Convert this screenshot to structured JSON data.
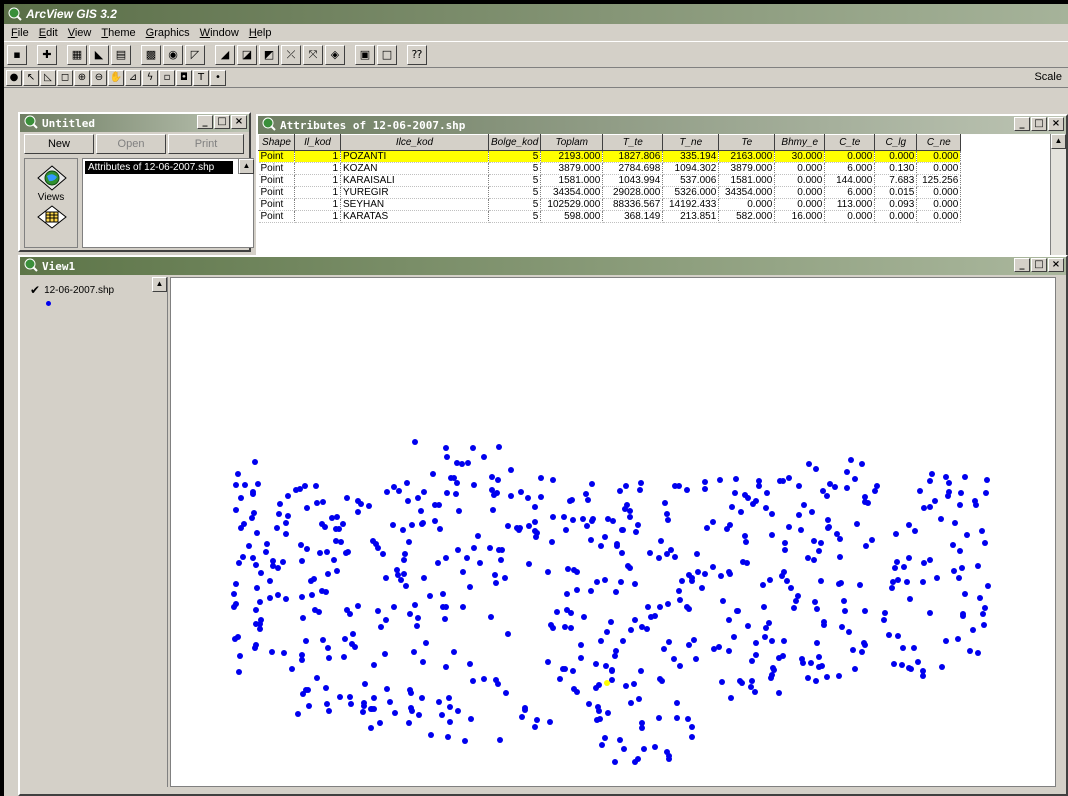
{
  "app": {
    "title": "ArcView GIS 3.2"
  },
  "menu": [
    {
      "label": "File",
      "key": "F",
      "rest": "ile"
    },
    {
      "label": "Edit",
      "key": "E",
      "rest": "dit"
    },
    {
      "label": "View",
      "key": "V",
      "rest": "iew"
    },
    {
      "label": "Theme",
      "key": "T",
      "rest": "heme"
    },
    {
      "label": "Graphics",
      "key": "G",
      "rest": "raphics"
    },
    {
      "label": "Window",
      "key": "W",
      "rest": "indow"
    },
    {
      "label": "Help",
      "key": "H",
      "rest": "elp"
    }
  ],
  "toolbar2": {
    "scale_label": "Scale",
    "text_tool": "T"
  },
  "project": {
    "title": "Untitled",
    "new_button": "New",
    "open_button": "Open",
    "print_button": "Print",
    "doc_type": "Views",
    "documents": [
      "Attributes of 12-06-2007.shp"
    ]
  },
  "attributes": {
    "title": "Attributes of 12-06-2007.shp",
    "columns": [
      "Shape",
      "Il_kod",
      "Ilce_kod",
      "Bolge_kod",
      "Toplam",
      "T_te",
      "T_ne",
      "Te",
      "Bhmy_e",
      "C_te",
      "C_lg",
      "C_ne"
    ],
    "rows": [
      [
        "Point",
        "1",
        "POZANTI",
        "5",
        "2193.000",
        "1827.806",
        "335.194",
        "2163.000",
        "30.000",
        "0.000",
        "0.000",
        "0.000"
      ],
      [
        "Point",
        "1",
        "KOZAN",
        "5",
        "3879.000",
        "2784.698",
        "1094.302",
        "3879.000",
        "0.000",
        "6.000",
        "0.130",
        "0.000"
      ],
      [
        "Point",
        "1",
        "KARAISALI",
        "5",
        "1581.000",
        "1043.994",
        "537.006",
        "1581.000",
        "0.000",
        "144.000",
        "7.683",
        "125.256"
      ],
      [
        "Point",
        "1",
        "YUREGIR",
        "5",
        "34354.000",
        "29028.000",
        "5326.000",
        "34354.000",
        "0.000",
        "6.000",
        "0.015",
        "0.000"
      ],
      [
        "Point",
        "1",
        "SEYHAN",
        "5",
        "102529.000",
        "88336.567",
        "14192.433",
        "0.000",
        "0.000",
        "113.000",
        "0.093",
        "0.000"
      ],
      [
        "Point",
        "1",
        "KARATAS",
        "5",
        "598.000",
        "368.149",
        "213.851",
        "582.000",
        "16.000",
        "0.000",
        "0.000",
        "0.000"
      ]
    ],
    "highlighted_row": 0
  },
  "view": {
    "title": "View1",
    "theme_name": "12-06-2007.shp",
    "theme_visible": true,
    "point_color": "#0000ee",
    "selected_color": "#ffff00"
  },
  "colors": {
    "titlebar": "#5a6e47",
    "highlight": "#ffff00",
    "points": "#0000ee"
  }
}
